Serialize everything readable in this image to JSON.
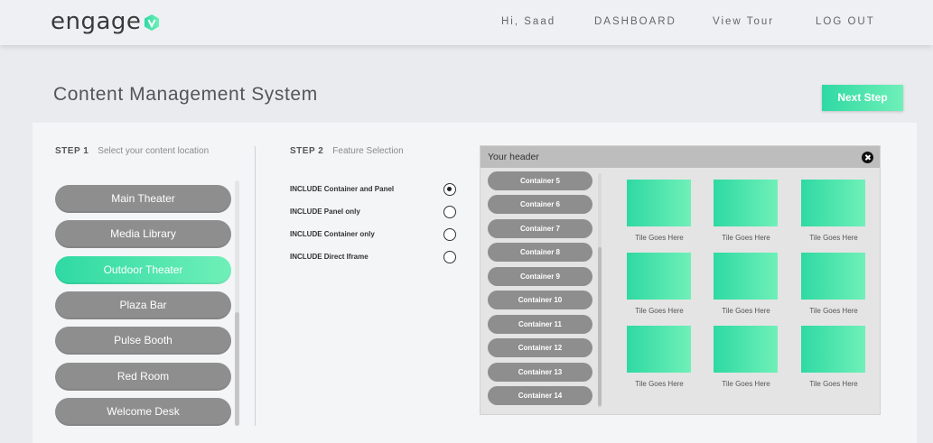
{
  "header": {
    "logo_text": "engage",
    "nav": [
      "Hi, Saad",
      "DASHBOARD",
      "View Tour",
      "LOG OUT"
    ]
  },
  "page": {
    "title": "Content Management System",
    "next_button": "Next Step"
  },
  "step1": {
    "number": "STEP 1",
    "caption": "Select your content location",
    "locations": [
      {
        "label": "Main Theater",
        "active": false
      },
      {
        "label": "Media Library",
        "active": false
      },
      {
        "label": "Outdoor Theater",
        "active": true
      },
      {
        "label": "Plaza Bar",
        "active": false
      },
      {
        "label": "Pulse Booth",
        "active": false
      },
      {
        "label": "Red Room",
        "active": false
      },
      {
        "label": "Welcome Desk",
        "active": false
      }
    ]
  },
  "step2": {
    "number": "STEP 2",
    "caption": "Feature Selection",
    "options": [
      {
        "label": "INCLUDE Container and Panel",
        "checked": true
      },
      {
        "label": "INCLUDE Panel only",
        "checked": false
      },
      {
        "label": "INCLUDE Container only",
        "checked": false
      },
      {
        "label": "INCLUDE Direct Iframe",
        "checked": false
      }
    ]
  },
  "preview": {
    "header": "Your header",
    "containers": [
      "Container 5",
      "Container 6",
      "Container 7",
      "Container 8",
      "Container 9",
      "Container 10",
      "Container 11",
      "Container 12",
      "Container 13",
      "Container 14"
    ],
    "tiles": [
      "Tile Goes Here",
      "Tile Goes Here",
      "Tile Goes Here",
      "Tile Goes Here",
      "Tile Goes Here",
      "Tile Goes Here",
      "Tile Goes Here",
      "Tile Goes Here",
      "Tile Goes Here"
    ]
  },
  "colors": {
    "accent_start": "#2fd9a3",
    "accent_end": "#6ff0b8",
    "button_gray": "#8e8e8e"
  }
}
